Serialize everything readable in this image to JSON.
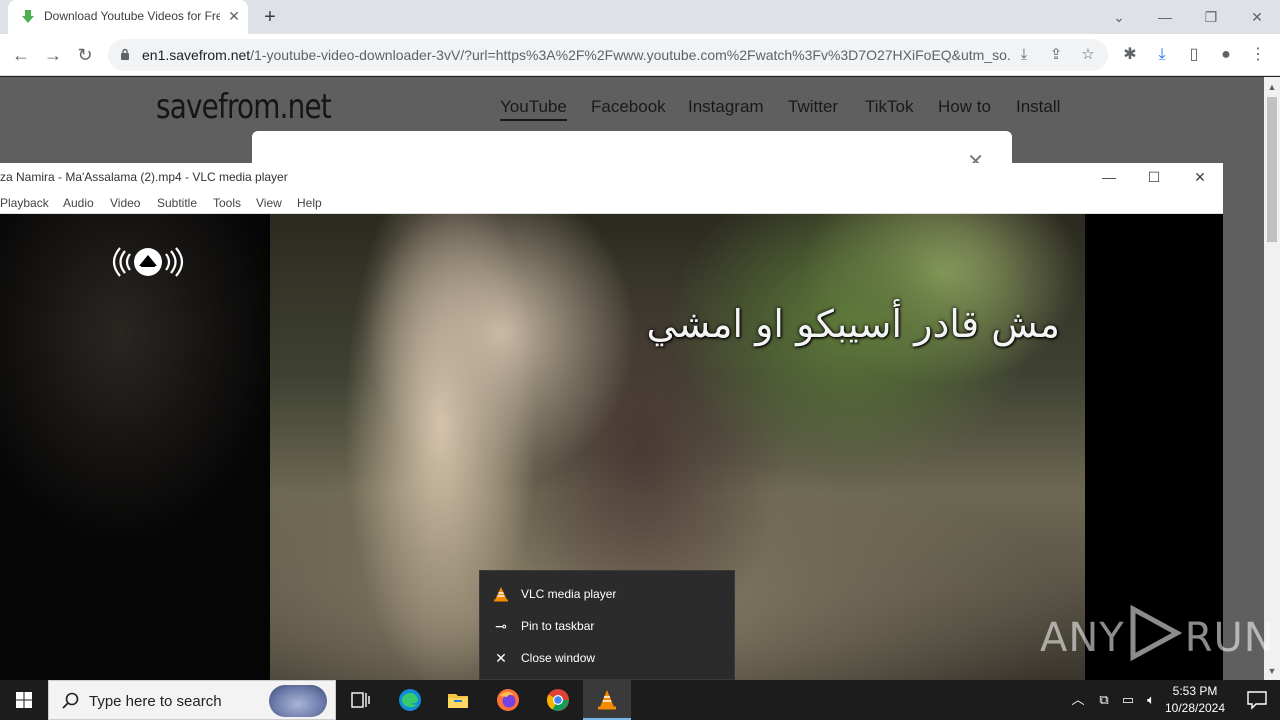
{
  "browser": {
    "tab_title": "Download Youtube Videos for Free",
    "tab_close": "✕",
    "new_tab": "+",
    "url_host": "en1.savefrom.net",
    "url_path": "/1-youtube-video-downloader-3vV/?url=https%3A%2F%2Fwww.youtube.com%2Fwatch%3Fv%3D7O27HXiFoEQ&utm_so..."
  },
  "site": {
    "logo": "savefrom.net",
    "nav": [
      "YouTube",
      "Facebook",
      "Instagram",
      "Twitter",
      "TikTok",
      "How to",
      "Install"
    ],
    "dialog_close": "✕"
  },
  "vlc": {
    "title": "za Namira - Ma'Assalama  (2).mp4 - VLC media player",
    "menu": [
      "Playback",
      "Audio",
      "Video",
      "Subtitle",
      "Tools",
      "View",
      "Help"
    ],
    "subtitle_text": "مش قادر أسيبكو او امشي"
  },
  "jumplist": {
    "items": [
      {
        "label": "VLC media player",
        "icon": "vlc-cone-icon"
      },
      {
        "label": "Pin to taskbar",
        "icon": "pin-icon"
      },
      {
        "label": "Close window",
        "icon": "close-icon"
      }
    ]
  },
  "watermark": {
    "left": "ANY",
    "right": "RUN"
  },
  "taskbar": {
    "search_placeholder": "Type here to search",
    "time": "5:53 PM",
    "date": "10/28/2024"
  },
  "colors": {
    "accent_underline": "#76b9ed",
    "taskbar_bg": "#1c1c1c",
    "jumplist_bg": "#2b2b2b",
    "site_overlay_bg": "#5f5f5f"
  }
}
